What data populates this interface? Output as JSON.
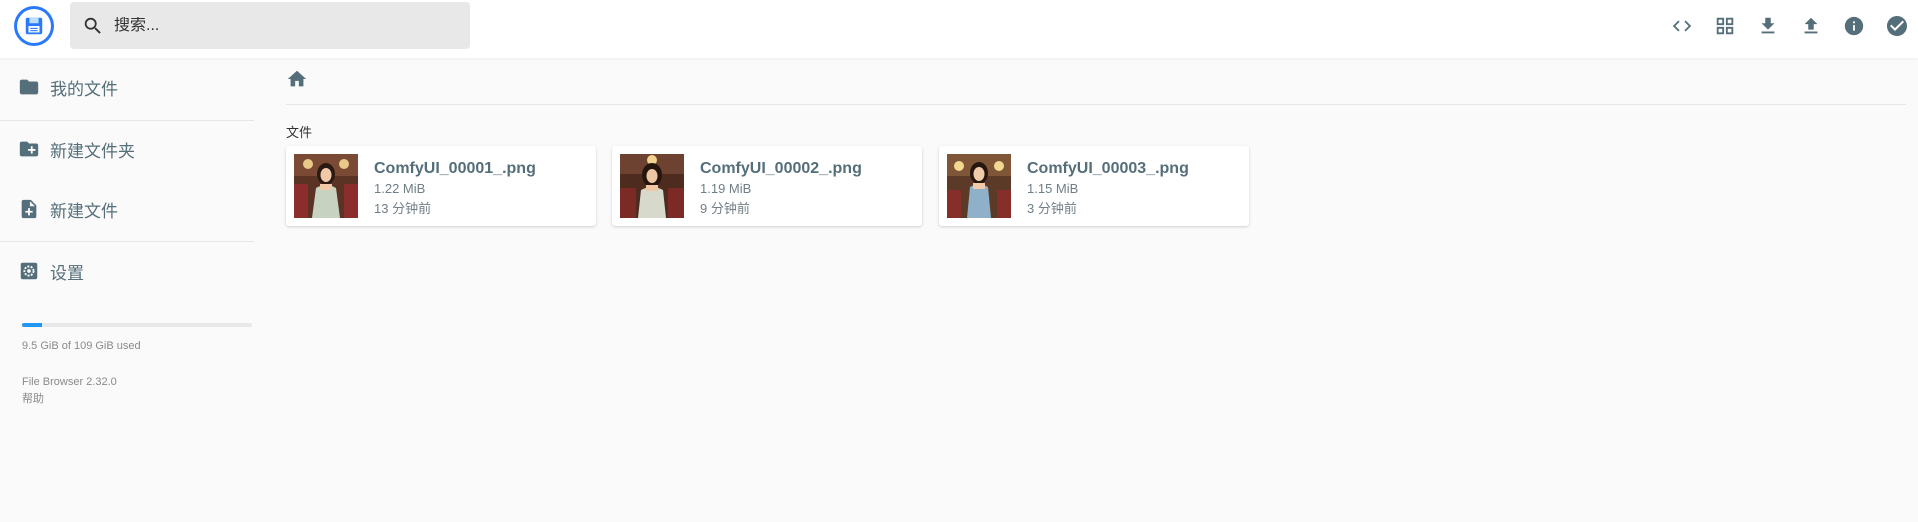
{
  "header": {
    "search_placeholder": "搜索...",
    "actions": [
      {
        "name": "code-view-icon"
      },
      {
        "name": "grid-view-icon"
      },
      {
        "name": "download-icon"
      },
      {
        "name": "upload-icon"
      },
      {
        "name": "info-icon"
      },
      {
        "name": "check-circle-icon"
      }
    ]
  },
  "sidebar": {
    "items": [
      {
        "label": "我的文件",
        "icon": "folder-icon"
      },
      {
        "label": "新建文件夹",
        "icon": "create-folder-icon"
      },
      {
        "label": "新建文件",
        "icon": "new-file-icon"
      },
      {
        "label": "设置",
        "icon": "settings-icon"
      }
    ],
    "usage_text": "9.5 GiB of 109 GiB used",
    "usage_fraction": 0.087,
    "version": "File Browser 2.32.0",
    "help": "帮助"
  },
  "main": {
    "section_title": "文件",
    "files": [
      {
        "name": "ComfyUI_00001_.png",
        "size": "1.22 MiB",
        "modified": "13 分钟前"
      },
      {
        "name": "ComfyUI_00002_.png",
        "size": "1.19 MiB",
        "modified": "9 分钟前"
      },
      {
        "name": "ComfyUI_00003_.png",
        "size": "1.15 MiB",
        "modified": "3 分钟前"
      }
    ]
  },
  "colors": {
    "accent": "#2979ff",
    "icon": "#546e7a",
    "usage_bar": "#2196f3"
  }
}
